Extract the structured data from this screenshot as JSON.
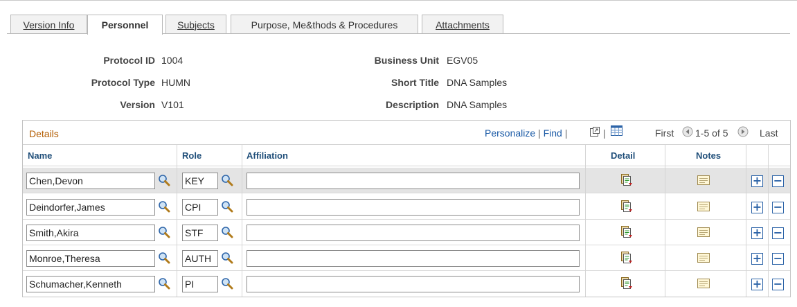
{
  "tabs": [
    {
      "label": "Version Info"
    },
    {
      "label": "Personnel"
    },
    {
      "label": "Subjects"
    },
    {
      "label": "Purpose, Me&thods & Procedures"
    },
    {
      "label": "Attachments"
    }
  ],
  "header": {
    "protocol_id_label": "Protocol ID",
    "protocol_id": "1004",
    "protocol_type_label": "Protocol Type",
    "protocol_type": "HUMN",
    "version_label": "Version",
    "version": "V101",
    "business_unit_label": "Business Unit",
    "business_unit": "EGV05",
    "short_title_label": "Short Title",
    "short_title": "DNA Samples",
    "description_label": "Description",
    "description": "DNA Samples"
  },
  "grid": {
    "title": "Details",
    "personalize": "Personalize",
    "find": "Find",
    "first": "First",
    "range": "1-5 of 5",
    "last": "Last",
    "columns": {
      "name": "Name",
      "role": "Role",
      "affiliation": "Affiliation",
      "detail": "Detail",
      "notes": "Notes"
    },
    "rows": [
      {
        "name": "Chen,Devon",
        "role": "KEY",
        "affiliation": ""
      },
      {
        "name": "Deindorfer,James",
        "role": "CPI",
        "affiliation": ""
      },
      {
        "name": "Smith,Akira",
        "role": "STF",
        "affiliation": ""
      },
      {
        "name": "Monroe,Theresa",
        "role": "AUTH",
        "affiliation": ""
      },
      {
        "name": "Schumacher,Kenneth",
        "role": "PI",
        "affiliation": ""
      }
    ]
  },
  "icons": {
    "lookup": "magnifier-icon",
    "detail": "detail-document-icon",
    "notes": "notes-icon",
    "add": "plus-icon",
    "delete": "minus-icon",
    "zoom": "view-all-icon",
    "download": "spreadsheet-icon"
  },
  "colors": {
    "accent_link": "#1a5aa6",
    "grid_title": "#b35c00",
    "column_header": "#1f4e79"
  }
}
